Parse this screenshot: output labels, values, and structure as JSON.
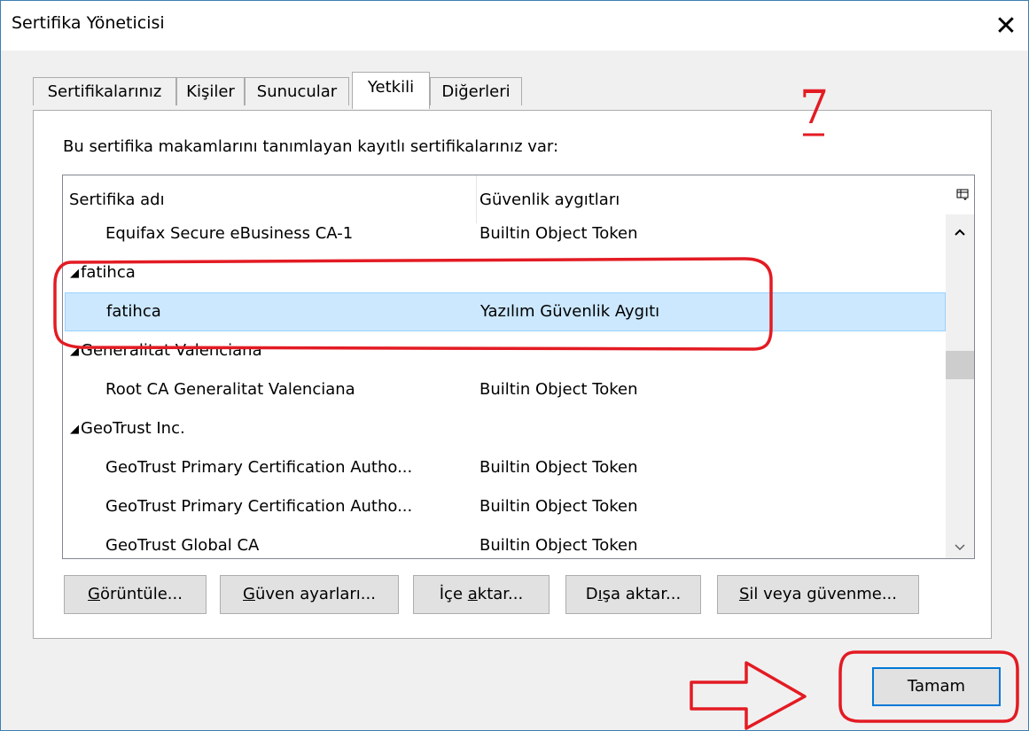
{
  "window": {
    "title": "Sertifika Yöneticisi",
    "close_glyph": "✕"
  },
  "tabs": [
    {
      "label": "Sertifikalarınız",
      "active": false
    },
    {
      "label": "Kişiler",
      "active": false
    },
    {
      "label": "Sunucular",
      "active": false
    },
    {
      "label": "Yetkili",
      "active": true
    },
    {
      "label": "Diğerleri",
      "active": false
    }
  ],
  "panel": {
    "intro_text": "Bu sertifika makamlarını tanımlayan kayıtlı sertifikalarınız var:"
  },
  "list": {
    "column_headers": {
      "name": "Sertifika adı",
      "device": "Güvenlik aygıtları"
    },
    "picker_icon": "column-picker-icon",
    "rows": [
      {
        "type": "cert",
        "name": "Equifax Secure eBusiness CA-1",
        "device": "Builtin Object Token",
        "selected": false
      },
      {
        "type": "group",
        "name": "fatihca",
        "device": "",
        "selected": false
      },
      {
        "type": "cert",
        "name": "fatihca",
        "device": "Yazılım Güvenlik Aygıtı",
        "selected": true
      },
      {
        "type": "group",
        "name": "Generalitat Valenciana",
        "device": "",
        "selected": false
      },
      {
        "type": "cert",
        "name": "Root CA Generalitat Valenciana",
        "device": "Builtin Object Token",
        "selected": false
      },
      {
        "type": "group",
        "name": "GeoTrust Inc.",
        "device": "",
        "selected": false
      },
      {
        "type": "cert",
        "name": "GeoTrust Primary Certification Autho...",
        "device": "Builtin Object Token",
        "selected": false
      },
      {
        "type": "cert",
        "name": "GeoTrust Primary Certification Autho...",
        "device": "Builtin Object Token",
        "selected": false
      },
      {
        "type": "cert",
        "name": "GeoTrust Global CA",
        "device": "Builtin Object Token",
        "selected": false
      }
    ]
  },
  "buttons": {
    "view": {
      "before": "",
      "mnemonic": "G",
      "after": "örüntüle..."
    },
    "trust": {
      "before": "",
      "mnemonic": "G",
      "after": "üven ayarları..."
    },
    "import": {
      "before": "İçe ",
      "mnemonic": "a",
      "after": "ktar..."
    },
    "export": {
      "before": "D",
      "mnemonic": "ı",
      "after": "şa aktar..."
    },
    "delete": {
      "before": "",
      "mnemonic": "S",
      "after": "il veya güvenme..."
    },
    "ok": "Tamam"
  },
  "annotation": {
    "step_number": "7",
    "color": "#e31b23"
  },
  "colors": {
    "selection": "#cce8ff",
    "focus_border": "#0078d7"
  }
}
